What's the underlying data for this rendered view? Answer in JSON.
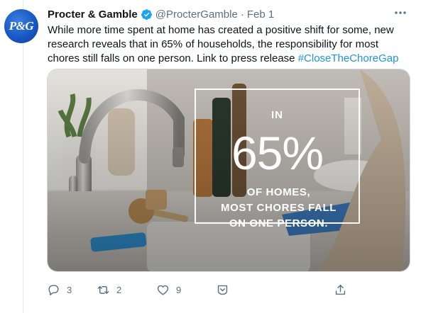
{
  "author": {
    "avatar_text": "P&G",
    "display_name": "Procter & Gamble",
    "handle": "@ProcterGamble",
    "separator": "·",
    "date": "Feb 1",
    "verified": true
  },
  "tweet": {
    "text": "While more time spent at home has created a positive shift for some, new research reveals that in 65% of households, the responsibility for most chores still falls on one person. Link to press release ",
    "hashtag": "#CloseTheChoreGap"
  },
  "media": {
    "overlay_in": "IN",
    "overlay_big": "65%",
    "overlay_line1": "OF HOMES,",
    "overlay_line2": "MOST CHORES FALL",
    "overlay_line3": "ON ONE PERSON."
  },
  "actions": {
    "reply_count": "3",
    "retweet_count": "2",
    "like_count": "9"
  },
  "icons": {
    "verified": "verified-badge-icon",
    "more": "more-options-icon",
    "reply": "reply-icon",
    "retweet": "retweet-icon",
    "like": "heart-icon",
    "save": "save-icon",
    "share": "share-icon"
  },
  "colors": {
    "text": "#0f1419",
    "secondary": "#5b7083",
    "link": "#1b95e0",
    "verified": "#1da1f2"
  }
}
